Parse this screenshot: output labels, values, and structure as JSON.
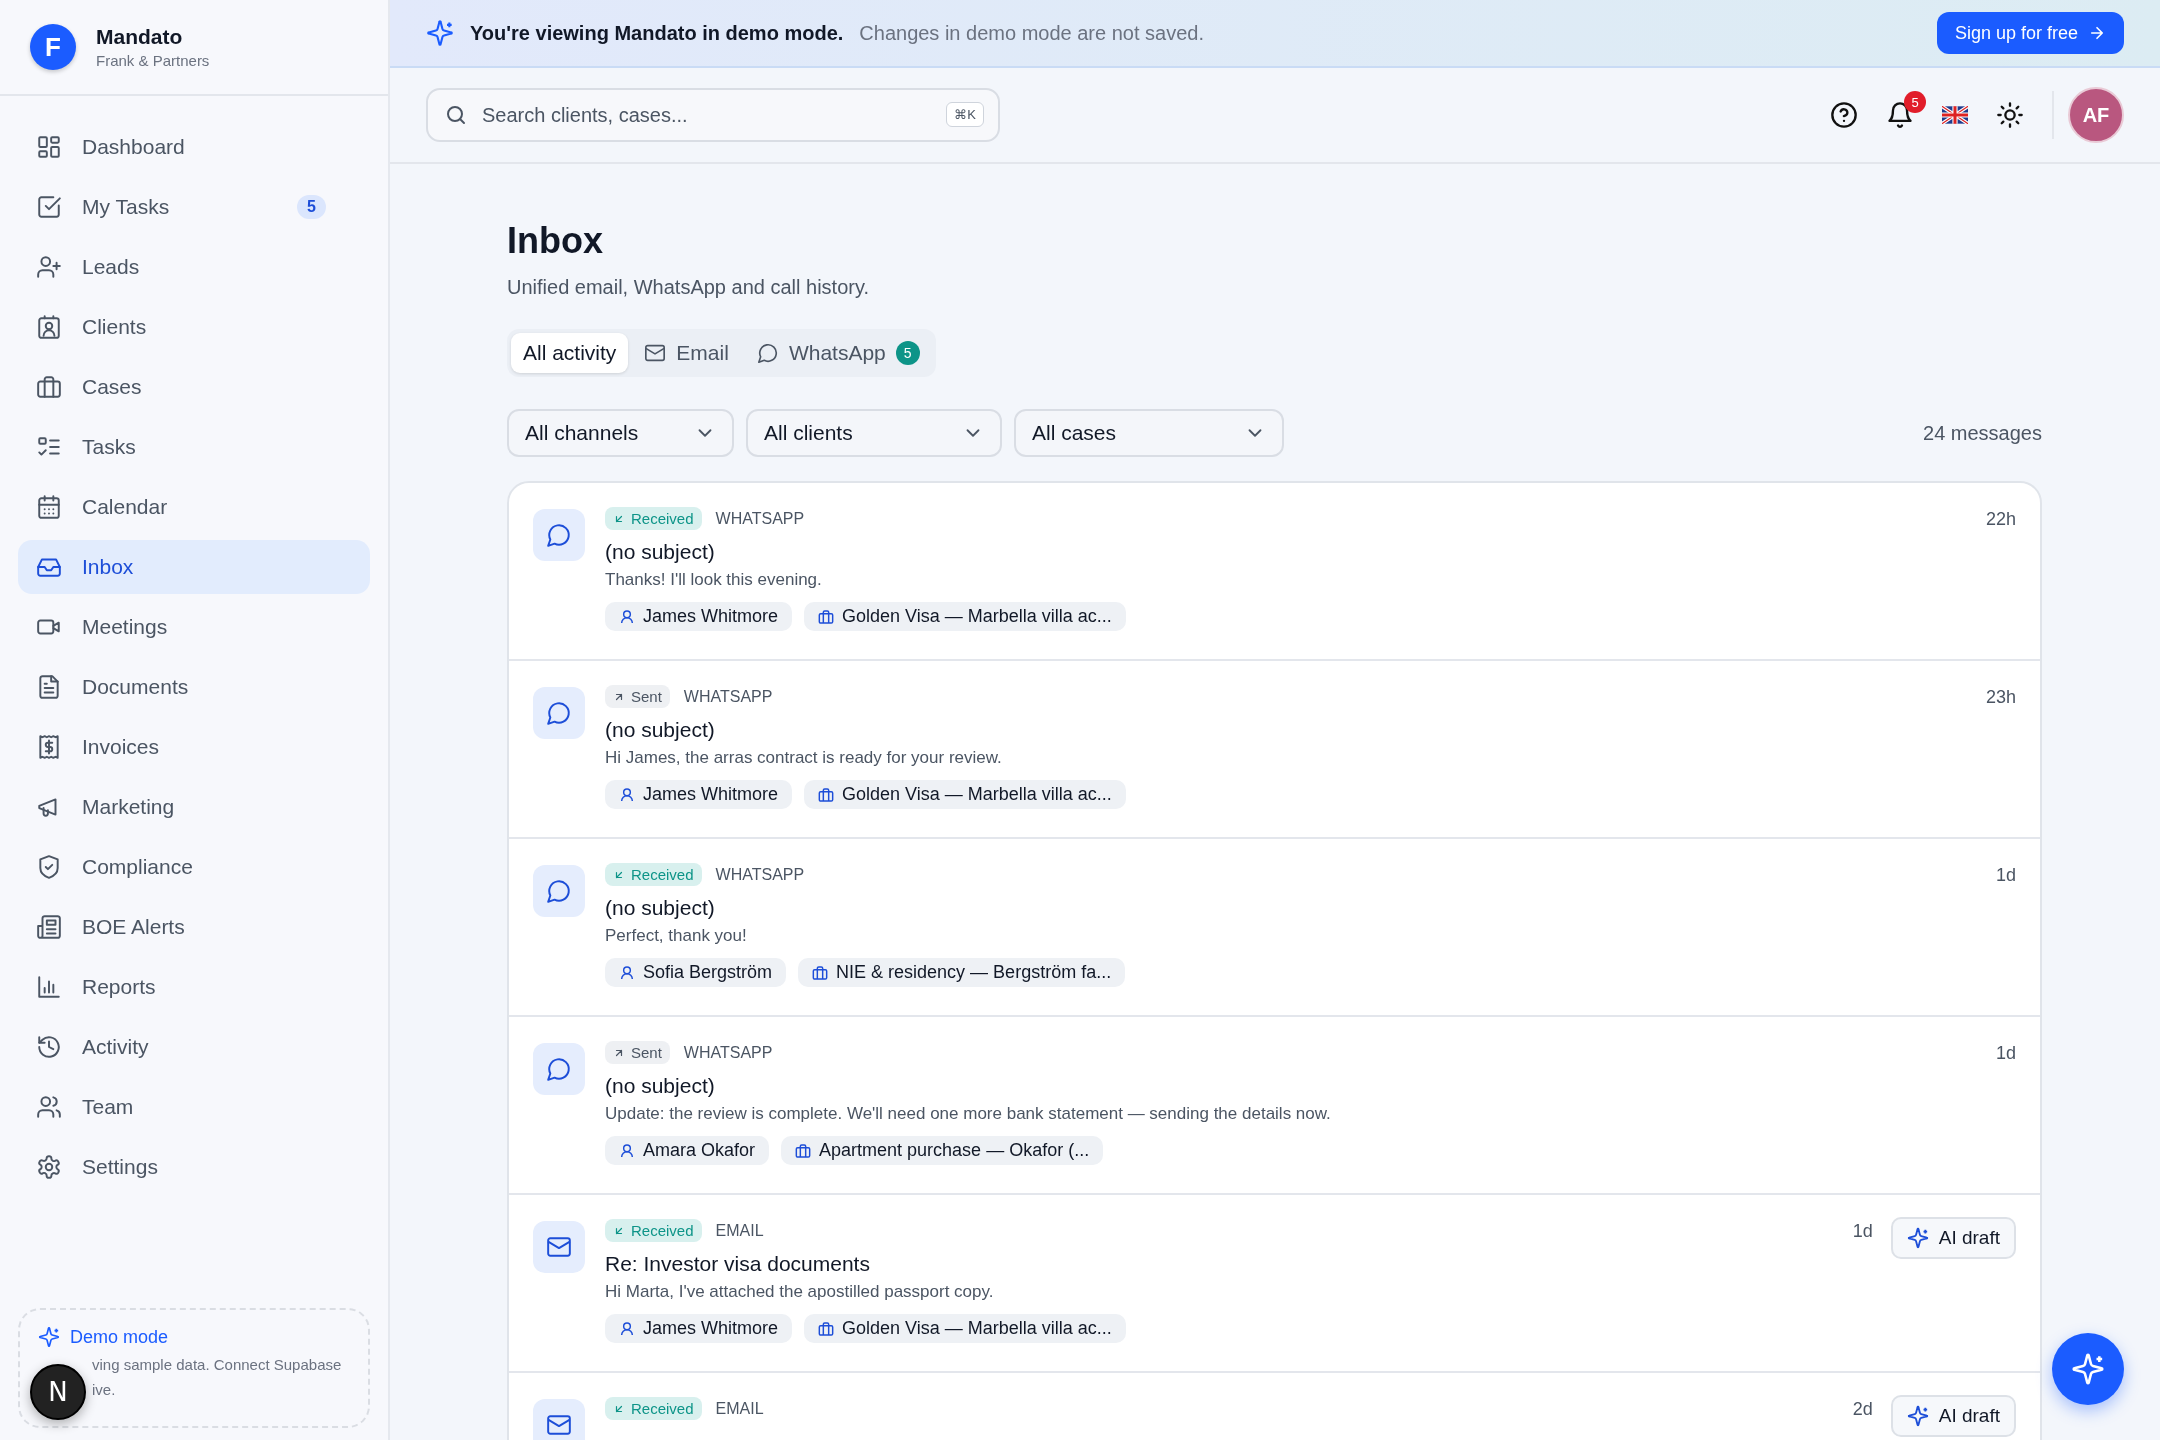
{
  "brand": {
    "initial": "F",
    "name": "Mandato",
    "org": "Frank & Partners"
  },
  "sidebar": {
    "items": [
      {
        "label": "Dashboard",
        "selected": false
      },
      {
        "label": "My Tasks",
        "selected": false,
        "badge": "5"
      },
      {
        "label": "Leads",
        "selected": false
      },
      {
        "label": "Clients",
        "selected": false
      },
      {
        "label": "Cases",
        "selected": false
      },
      {
        "label": "Tasks",
        "selected": false
      },
      {
        "label": "Calendar",
        "selected": false
      },
      {
        "label": "Inbox",
        "selected": true
      },
      {
        "label": "Meetings",
        "selected": false
      },
      {
        "label": "Documents",
        "selected": false
      },
      {
        "label": "Invoices",
        "selected": false
      },
      {
        "label": "Marketing",
        "selected": false
      },
      {
        "label": "Compliance",
        "selected": false
      },
      {
        "label": "BOE Alerts",
        "selected": false
      },
      {
        "label": "Reports",
        "selected": false
      },
      {
        "label": "Activity",
        "selected": false
      },
      {
        "label": "Team",
        "selected": false
      },
      {
        "label": "Settings",
        "selected": false
      }
    ],
    "demo": {
      "title": "Demo mode",
      "line_1": "ving sample data. Connect Supabase",
      "line_2": "ive."
    },
    "floating_button": {
      "initial": "N"
    }
  },
  "banner": {
    "title": "You're viewing Mandato in demo mode.",
    "note": "Changes in demo mode are not saved.",
    "button": "Sign up for free"
  },
  "header": {
    "search": {
      "placeholder": "Search clients, cases...",
      "shortcut": "⌘K"
    },
    "notifications": "5",
    "avatar": "AF"
  },
  "page": {
    "title": "Inbox",
    "subtitle": "Unified email, WhatsApp and call history."
  },
  "tabs": [
    {
      "label": "All activity",
      "kind": "all",
      "selected": true
    },
    {
      "label": "Email",
      "kind": "email",
      "selected": false
    },
    {
      "label": "WhatsApp",
      "kind": "whatsapp",
      "selected": false,
      "badge": "5"
    }
  ],
  "filters": [
    "All channels",
    "All clients",
    "All cases"
  ],
  "count": "24 messages",
  "messages": [
    {
      "kind": "whatsapp",
      "status": {
        "kind": "received",
        "label": "Received"
      },
      "channel": "WHATSAPP",
      "time": "22h",
      "subject": "(no subject)",
      "preview": "Thanks! I'll look this evening.",
      "client": "James Whitmore",
      "case": "Golden Visa — Marbella villa ac..."
    },
    {
      "kind": "whatsapp",
      "status": {
        "kind": "sent",
        "label": "Sent"
      },
      "channel": "WHATSAPP",
      "time": "23h",
      "subject": "(no subject)",
      "preview": "Hi James, the arras contract is ready for your review.",
      "client": "James Whitmore",
      "case": "Golden Visa — Marbella villa ac..."
    },
    {
      "kind": "whatsapp",
      "status": {
        "kind": "received",
        "label": "Received"
      },
      "channel": "WHATSAPP",
      "time": "1d",
      "subject": "(no subject)",
      "preview": "Perfect, thank you!",
      "client": "Sofia Bergström",
      "case": "NIE & residency — Bergström fa..."
    },
    {
      "kind": "whatsapp",
      "status": {
        "kind": "sent",
        "label": "Sent"
      },
      "channel": "WHATSAPP",
      "time": "1d",
      "subject": "(no subject)",
      "preview": "Update: the review is complete. We'll need one more bank statement — sending the details now.",
      "client": "Amara Okafor",
      "case": "Apartment purchase — Okafor (..."
    },
    {
      "kind": "email",
      "status": {
        "kind": "received",
        "label": "Received"
      },
      "channel": "EMAIL",
      "time": "1d",
      "ai_button": "AI draft",
      "subject": "Re: Investor visa documents",
      "preview": "Hi Marta, I've attached the apostilled passport copy.",
      "client": "James Whitmore",
      "case": "Golden Visa — Marbella villa ac..."
    },
    {
      "kind": "email",
      "status": {
        "kind": "received",
        "label": "Received"
      },
      "channel": "EMAIL",
      "time": "2d",
      "ai_button": "AI draft"
    }
  ]
}
